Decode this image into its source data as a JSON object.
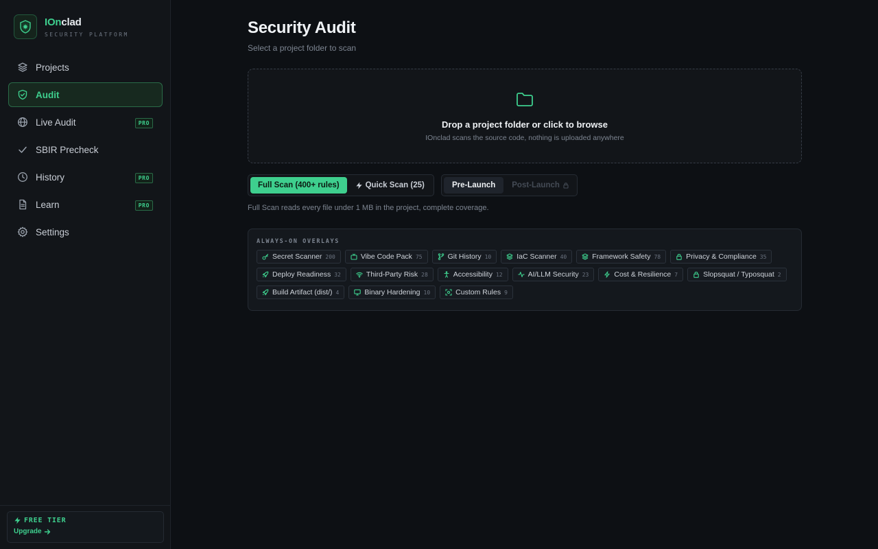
{
  "brand": {
    "name_accent": "IOn",
    "name_rest": "clad",
    "subtitle": "SECURITY PLATFORM"
  },
  "sidebar": {
    "items": [
      {
        "label": "Projects",
        "icon": "layers-icon",
        "active": false,
        "pro": false
      },
      {
        "label": "Audit",
        "icon": "shield-icon",
        "active": true,
        "pro": false
      },
      {
        "label": "Live Audit",
        "icon": "globe-icon",
        "active": false,
        "pro": true,
        "badge": "PRO"
      },
      {
        "label": "SBIR Precheck",
        "icon": "check-icon",
        "active": false,
        "pro": false
      },
      {
        "label": "History",
        "icon": "clock-icon",
        "active": false,
        "pro": true,
        "badge": "PRO"
      },
      {
        "label": "Learn",
        "icon": "document-icon",
        "active": false,
        "pro": true,
        "badge": "PRO"
      },
      {
        "label": "Settings",
        "icon": "gear-icon",
        "active": false,
        "pro": false
      }
    ],
    "footer": {
      "tier": "FREE TIER",
      "upgrade": "Upgrade"
    }
  },
  "main": {
    "title": "Security Audit",
    "subtitle": "Select a project folder to scan",
    "dropzone": {
      "title": "Drop a project folder or click to browse",
      "subtitle": "IOnclad scans the source code, nothing is uploaded anywhere"
    },
    "scan_modes": {
      "full": "Full Scan (400+ rules)",
      "quick": "Quick Scan (25)"
    },
    "phases": {
      "pre": "Pre-Launch",
      "post": "Post-Launch"
    },
    "mode_note": "Full Scan reads every file under 1 MB in the project, complete coverage.",
    "overlays": {
      "label": "ALWAYS-ON OVERLAYS",
      "chips": [
        {
          "label": "Secret Scanner",
          "count": "200",
          "icon": "key-icon"
        },
        {
          "label": "Vibe Code Pack",
          "count": "75",
          "icon": "tv-icon"
        },
        {
          "label": "Git History",
          "count": "10",
          "icon": "git-branch-icon"
        },
        {
          "label": "IaC Scanner",
          "count": "40",
          "icon": "layers-icon"
        },
        {
          "label": "Framework Safety",
          "count": "78",
          "icon": "layers-icon"
        },
        {
          "label": "Privacy & Compliance",
          "count": "35",
          "icon": "lock-icon"
        },
        {
          "label": "Deploy Readiness",
          "count": "32",
          "icon": "rocket-icon"
        },
        {
          "label": "Third-Party Risk",
          "count": "28",
          "icon": "wifi-icon"
        },
        {
          "label": "Accessibility",
          "count": "12",
          "icon": "accessibility-icon"
        },
        {
          "label": "AI/LLM Security",
          "count": "23",
          "icon": "activity-icon"
        },
        {
          "label": "Cost & Resilience",
          "count": "7",
          "icon": "zap-icon"
        },
        {
          "label": "Slopsquat / Typosquat",
          "count": "2",
          "icon": "lock-icon"
        },
        {
          "label": "Build Artifact (dist/)",
          "count": "4",
          "icon": "rocket-icon"
        },
        {
          "label": "Binary Hardening",
          "count": "10",
          "icon": "monitor-icon"
        },
        {
          "label": "Custom Rules",
          "count": "9",
          "icon": "scan-icon"
        }
      ]
    }
  },
  "colors": {
    "accent": "#3ecf8e",
    "background": "#0d1014",
    "sidebar": "#121519"
  }
}
